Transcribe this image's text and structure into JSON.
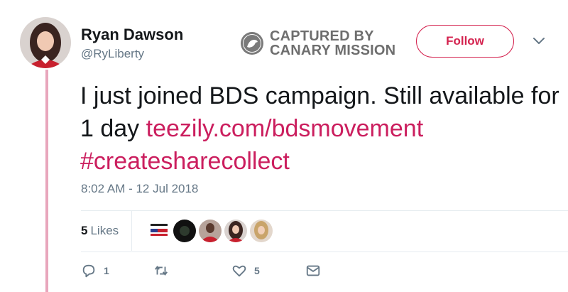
{
  "user": {
    "display_name": "Ryan Dawson",
    "handle": "@RyLiberty"
  },
  "watermark": {
    "line1": "CAPTURED BY",
    "line2": "CANARY MISSION"
  },
  "follow_label": "Follow",
  "tweet": {
    "text_plain": "I just joined BDS campaign. Still available for 1 day ",
    "link": "teezily.com/bdsmovement",
    "hashtag": "#createsharecollect",
    "timestamp": "8:02 AM - 12 Jul 2018"
  },
  "likes": {
    "count": "5",
    "label": "Likes",
    "liker_avatars": [
      "avatar-flag",
      "avatar-dark",
      "avatar-red",
      "avatar-girl",
      "avatar-blonde"
    ]
  },
  "actions": {
    "reply_count": "1",
    "retweet_count": "",
    "like_count": "5"
  },
  "colors": {
    "accent": "#cb1e5e",
    "follow_border": "#d4234f",
    "thread_line": "#e8a6bc",
    "muted": "#657786"
  }
}
